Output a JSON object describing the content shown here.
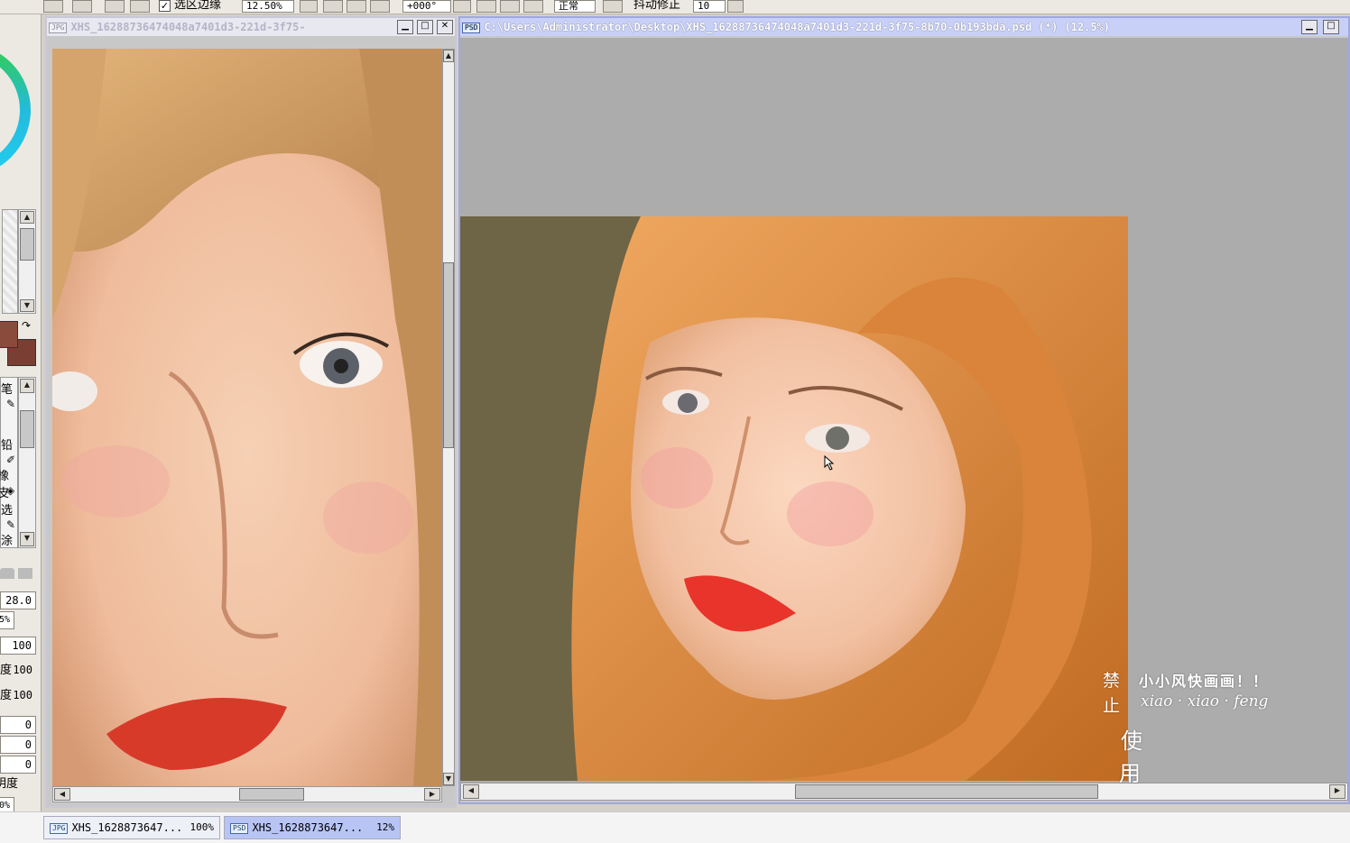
{
  "toolbar": {
    "selection_edge_label": "选区边缘",
    "zoom_value": "12.50%",
    "rotation_value": "+000°",
    "blend_mode": "正常",
    "stabilizer_label": "抖动修正",
    "stabilizer_value": "10"
  },
  "left_panel": {
    "brush_size": "28.0",
    "percent_value": "5%",
    "field_100_a": "100",
    "field_100_b_label": "度",
    "field_100_b": "100",
    "field_100_c_label": "度",
    "field_100_c": "100",
    "zero_a": "0",
    "zero_b": "0",
    "zero_c": "0",
    "density_label": "明度",
    "bottom_percent": "0%",
    "tool_labels": [
      "笔",
      "铅",
      "橡皮",
      "选",
      "涂"
    ],
    "main_color": "#8a4a3c",
    "sub_color": "#7a3e32"
  },
  "doc_left": {
    "badge": "JPG",
    "title": "XHS_16288736474048a7401d3-221d-3f75-",
    "canvas_colors": {
      "hair": "#c89a62",
      "bg": "#6b5a3a",
      "skin": "#f2c6a8"
    }
  },
  "doc_right": {
    "badge": "PSD",
    "title": "C:\\Users\\Administrator\\Desktop\\XHS_16288736474048a7401d3-221d-3f75-8b70-0b193bda.psd (*) (12.5%)",
    "canvas_colors": {
      "hair": "#d98a3e",
      "bg": "#6e6446",
      "skin": "#f4c8ae"
    }
  },
  "watermark": {
    "chars_col1": [
      "禁",
      "止"
    ],
    "chars_col2": [
      "使",
      "用"
    ],
    "line1": "小小风快画画！！",
    "line2": "xiao · xiao · feng"
  },
  "taskbar": {
    "items": [
      {
        "badge": "JPG",
        "name": "XHS_1628873647...",
        "zoom": "100%"
      },
      {
        "badge": "PSD",
        "name": "XHS_1628873647...",
        "zoom": "12%"
      }
    ]
  },
  "colors": {
    "window_border": "#9fa8e0",
    "titlebar_active": "#c8d0f8",
    "titlebar_inactive": "#e8e8f0",
    "canvas_bg": "#acacac"
  }
}
